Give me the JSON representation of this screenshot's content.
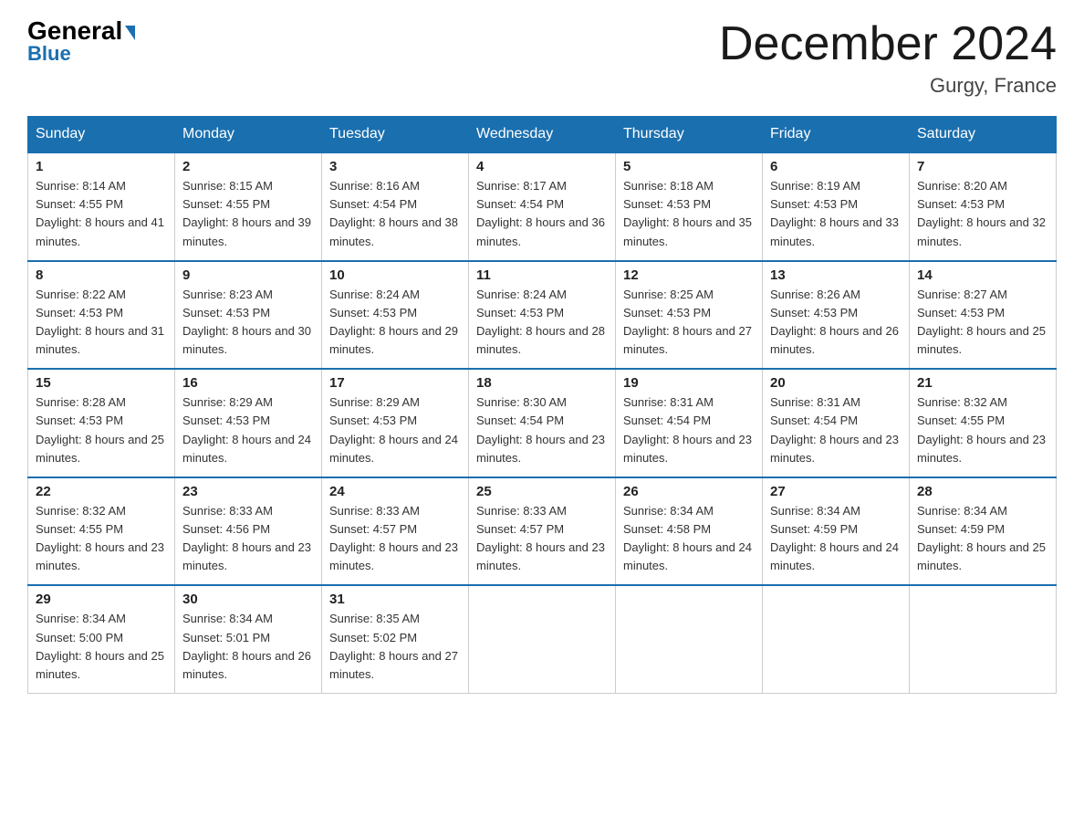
{
  "header": {
    "logo_general": "General",
    "logo_blue": "Blue",
    "month_title": "December 2024",
    "location": "Gurgy, France"
  },
  "days_of_week": [
    "Sunday",
    "Monday",
    "Tuesday",
    "Wednesday",
    "Thursday",
    "Friday",
    "Saturday"
  ],
  "weeks": [
    [
      {
        "num": "1",
        "sunrise": "8:14 AM",
        "sunset": "4:55 PM",
        "daylight": "8 hours and 41 minutes."
      },
      {
        "num": "2",
        "sunrise": "8:15 AM",
        "sunset": "4:55 PM",
        "daylight": "8 hours and 39 minutes."
      },
      {
        "num": "3",
        "sunrise": "8:16 AM",
        "sunset": "4:54 PM",
        "daylight": "8 hours and 38 minutes."
      },
      {
        "num": "4",
        "sunrise": "8:17 AM",
        "sunset": "4:54 PM",
        "daylight": "8 hours and 36 minutes."
      },
      {
        "num": "5",
        "sunrise": "8:18 AM",
        "sunset": "4:53 PM",
        "daylight": "8 hours and 35 minutes."
      },
      {
        "num": "6",
        "sunrise": "8:19 AM",
        "sunset": "4:53 PM",
        "daylight": "8 hours and 33 minutes."
      },
      {
        "num": "7",
        "sunrise": "8:20 AM",
        "sunset": "4:53 PM",
        "daylight": "8 hours and 32 minutes."
      }
    ],
    [
      {
        "num": "8",
        "sunrise": "8:22 AM",
        "sunset": "4:53 PM",
        "daylight": "8 hours and 31 minutes."
      },
      {
        "num": "9",
        "sunrise": "8:23 AM",
        "sunset": "4:53 PM",
        "daylight": "8 hours and 30 minutes."
      },
      {
        "num": "10",
        "sunrise": "8:24 AM",
        "sunset": "4:53 PM",
        "daylight": "8 hours and 29 minutes."
      },
      {
        "num": "11",
        "sunrise": "8:24 AM",
        "sunset": "4:53 PM",
        "daylight": "8 hours and 28 minutes."
      },
      {
        "num": "12",
        "sunrise": "8:25 AM",
        "sunset": "4:53 PM",
        "daylight": "8 hours and 27 minutes."
      },
      {
        "num": "13",
        "sunrise": "8:26 AM",
        "sunset": "4:53 PM",
        "daylight": "8 hours and 26 minutes."
      },
      {
        "num": "14",
        "sunrise": "8:27 AM",
        "sunset": "4:53 PM",
        "daylight": "8 hours and 25 minutes."
      }
    ],
    [
      {
        "num": "15",
        "sunrise": "8:28 AM",
        "sunset": "4:53 PM",
        "daylight": "8 hours and 25 minutes."
      },
      {
        "num": "16",
        "sunrise": "8:29 AM",
        "sunset": "4:53 PM",
        "daylight": "8 hours and 24 minutes."
      },
      {
        "num": "17",
        "sunrise": "8:29 AM",
        "sunset": "4:53 PM",
        "daylight": "8 hours and 24 minutes."
      },
      {
        "num": "18",
        "sunrise": "8:30 AM",
        "sunset": "4:54 PM",
        "daylight": "8 hours and 23 minutes."
      },
      {
        "num": "19",
        "sunrise": "8:31 AM",
        "sunset": "4:54 PM",
        "daylight": "8 hours and 23 minutes."
      },
      {
        "num": "20",
        "sunrise": "8:31 AM",
        "sunset": "4:54 PM",
        "daylight": "8 hours and 23 minutes."
      },
      {
        "num": "21",
        "sunrise": "8:32 AM",
        "sunset": "4:55 PM",
        "daylight": "8 hours and 23 minutes."
      }
    ],
    [
      {
        "num": "22",
        "sunrise": "8:32 AM",
        "sunset": "4:55 PM",
        "daylight": "8 hours and 23 minutes."
      },
      {
        "num": "23",
        "sunrise": "8:33 AM",
        "sunset": "4:56 PM",
        "daylight": "8 hours and 23 minutes."
      },
      {
        "num": "24",
        "sunrise": "8:33 AM",
        "sunset": "4:57 PM",
        "daylight": "8 hours and 23 minutes."
      },
      {
        "num": "25",
        "sunrise": "8:33 AM",
        "sunset": "4:57 PM",
        "daylight": "8 hours and 23 minutes."
      },
      {
        "num": "26",
        "sunrise": "8:34 AM",
        "sunset": "4:58 PM",
        "daylight": "8 hours and 24 minutes."
      },
      {
        "num": "27",
        "sunrise": "8:34 AM",
        "sunset": "4:59 PM",
        "daylight": "8 hours and 24 minutes."
      },
      {
        "num": "28",
        "sunrise": "8:34 AM",
        "sunset": "4:59 PM",
        "daylight": "8 hours and 25 minutes."
      }
    ],
    [
      {
        "num": "29",
        "sunrise": "8:34 AM",
        "sunset": "5:00 PM",
        "daylight": "8 hours and 25 minutes."
      },
      {
        "num": "30",
        "sunrise": "8:34 AM",
        "sunset": "5:01 PM",
        "daylight": "8 hours and 26 minutes."
      },
      {
        "num": "31",
        "sunrise": "8:35 AM",
        "sunset": "5:02 PM",
        "daylight": "8 hours and 27 minutes."
      },
      null,
      null,
      null,
      null
    ]
  ],
  "labels": {
    "sunrise": "Sunrise:",
    "sunset": "Sunset:",
    "daylight": "Daylight:"
  }
}
